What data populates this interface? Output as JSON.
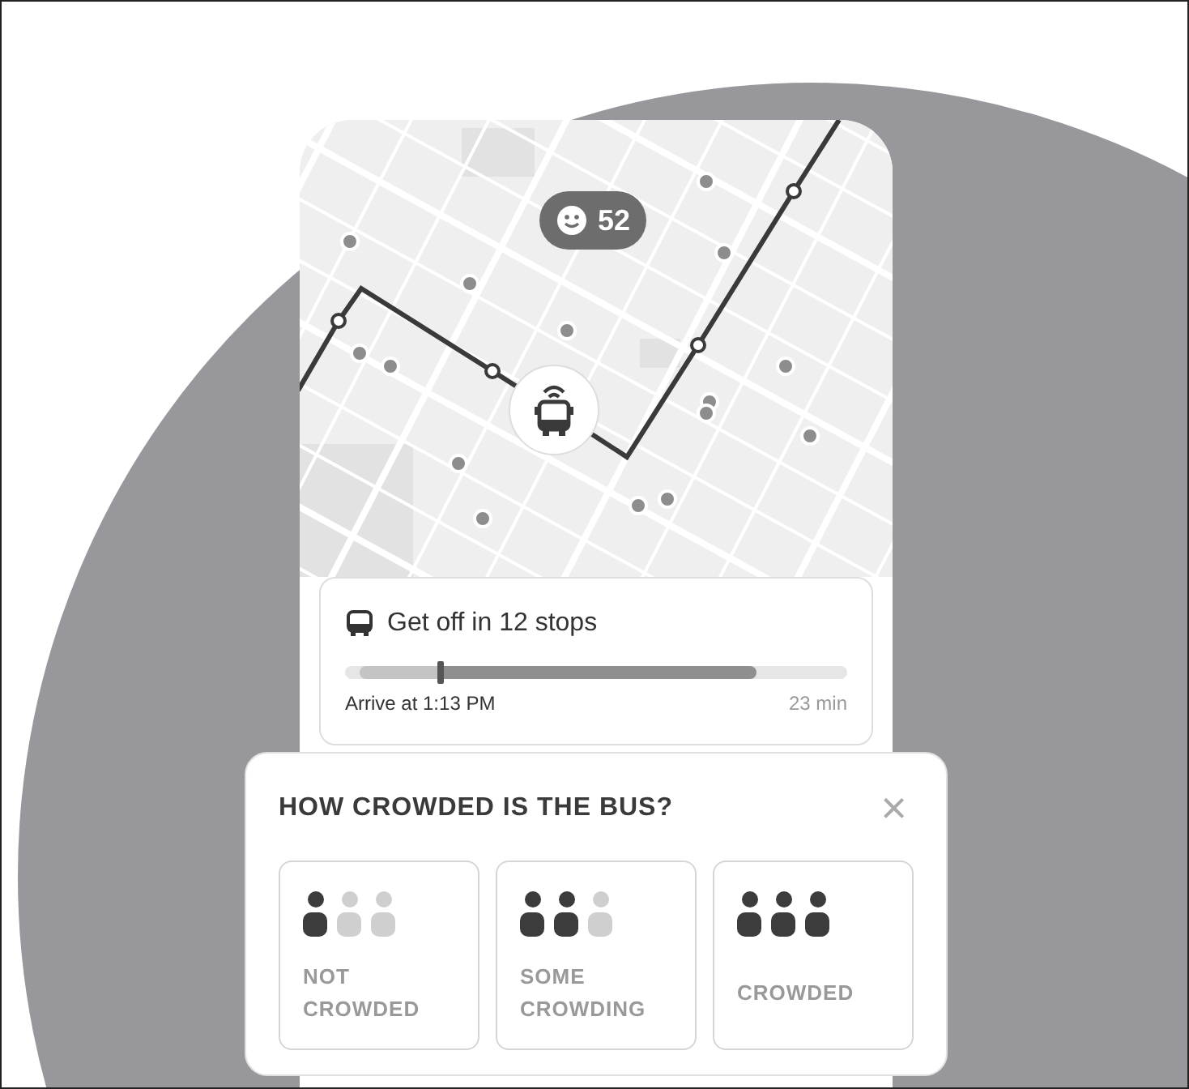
{
  "map": {
    "crowd_badge": "52"
  },
  "trip": {
    "title": "Get off in 12 stops",
    "progress": {
      "level": 0.19
    },
    "arrival": "Arrive at 1:13 PM",
    "duration": "23 min"
  },
  "crowd_prompt": {
    "title": "HOW CROWDED IS THE BUS?",
    "close": "×",
    "options": [
      {
        "label": "NOT CROWDED",
        "people": [
          {
            "filled": true
          },
          {
            "filled": false
          },
          {
            "filled": false
          }
        ]
      },
      {
        "label": "SOME CROWDING",
        "people": [
          {
            "filled": true
          },
          {
            "filled": true
          },
          {
            "filled": false
          }
        ]
      },
      {
        "label": "CROWDED",
        "people": [
          {
            "filled": true
          },
          {
            "filled": true
          },
          {
            "filled": true
          }
        ]
      }
    ]
  }
}
